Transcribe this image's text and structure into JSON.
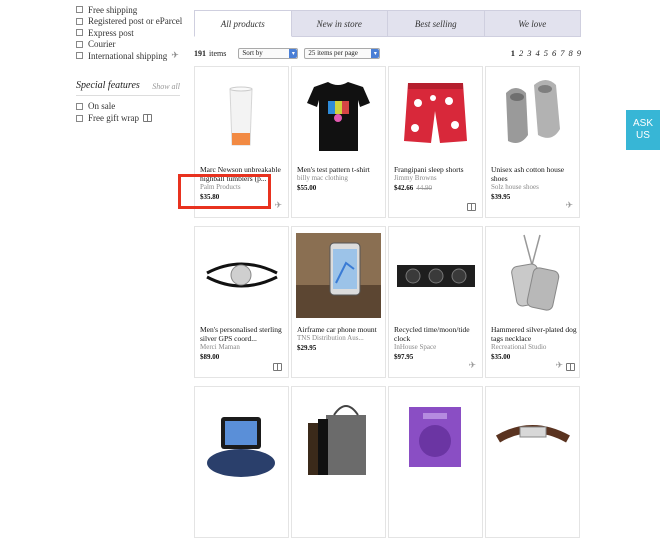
{
  "shipping_options": [
    {
      "label": "Free shipping"
    },
    {
      "label": "Registered post or eParcel"
    },
    {
      "label": "Express post"
    },
    {
      "label": "Courier"
    },
    {
      "label": "International shipping"
    }
  ],
  "special_features": {
    "title": "Special features",
    "show_all": "Show all",
    "options": [
      {
        "label": "On sale"
      },
      {
        "label": "Free gift wrap"
      }
    ]
  },
  "tabs": [
    {
      "label": "All products",
      "active": true
    },
    {
      "label": "New in store"
    },
    {
      "label": "Best selling"
    },
    {
      "label": "We love"
    }
  ],
  "toolbar": {
    "count": "191",
    "count_label": "items",
    "sort_value": "Sort by",
    "per_page_value": "25 items per page",
    "pages": [
      "1",
      "2",
      "3",
      "4",
      "5",
      "6",
      "7",
      "8",
      "9"
    ]
  },
  "products": [
    {
      "name": "Marc Newson unbreakable highball tumblers (p...",
      "brand": "Palm Products",
      "price": "$35.80",
      "old_price": "",
      "badge": "ship-icon"
    },
    {
      "name": "Men's test pattern t-shirt",
      "brand": "billy mac clothing",
      "price": "$55.00",
      "old_price": "",
      "badge": ""
    },
    {
      "name": "Frangipani sleep shorts",
      "brand": "Jimmy Browns",
      "price": "$42.66",
      "old_price": "44.90",
      "badge": "gift-icon"
    },
    {
      "name": "Unisex ash cotton house shoes",
      "brand": "Solz house shoes",
      "price": "$39.95",
      "old_price": "",
      "badge": "ship-icon"
    },
    {
      "name": "Men's personalised sterling silver GPS coord...",
      "brand": "Merci Maman",
      "price": "$89.00",
      "old_price": "",
      "badge": "gift-icon"
    },
    {
      "name": "Airframe car phone mount",
      "brand": "TNS Distribution Aus...",
      "price": "$29.95",
      "old_price": "",
      "badge": ""
    },
    {
      "name": "Recycled time/moon/tide clock",
      "brand": "InHouse Space",
      "price": "$97.95",
      "old_price": "",
      "badge": "ship-icon"
    },
    {
      "name": "Hammered silver-plated dog tags necklace",
      "brand": "Recreational Studio",
      "price": "$35.00",
      "old_price": "",
      "badge": "ship-gift"
    },
    {
      "name": "",
      "brand": "",
      "price": "",
      "old_price": "",
      "badge": ""
    },
    {
      "name": "",
      "brand": "",
      "price": "",
      "old_price": "",
      "badge": ""
    },
    {
      "name": "",
      "brand": "",
      "price": "",
      "old_price": "",
      "badge": ""
    },
    {
      "name": "",
      "brand": "",
      "price": "",
      "old_price": "",
      "badge": ""
    }
  ],
  "ask_us": {
    "line1": "ASK",
    "line2": "US"
  },
  "colors": {
    "accent": "#37b6d6",
    "highlight": "#e8321f",
    "tab_bg": "#e2e2ee"
  }
}
